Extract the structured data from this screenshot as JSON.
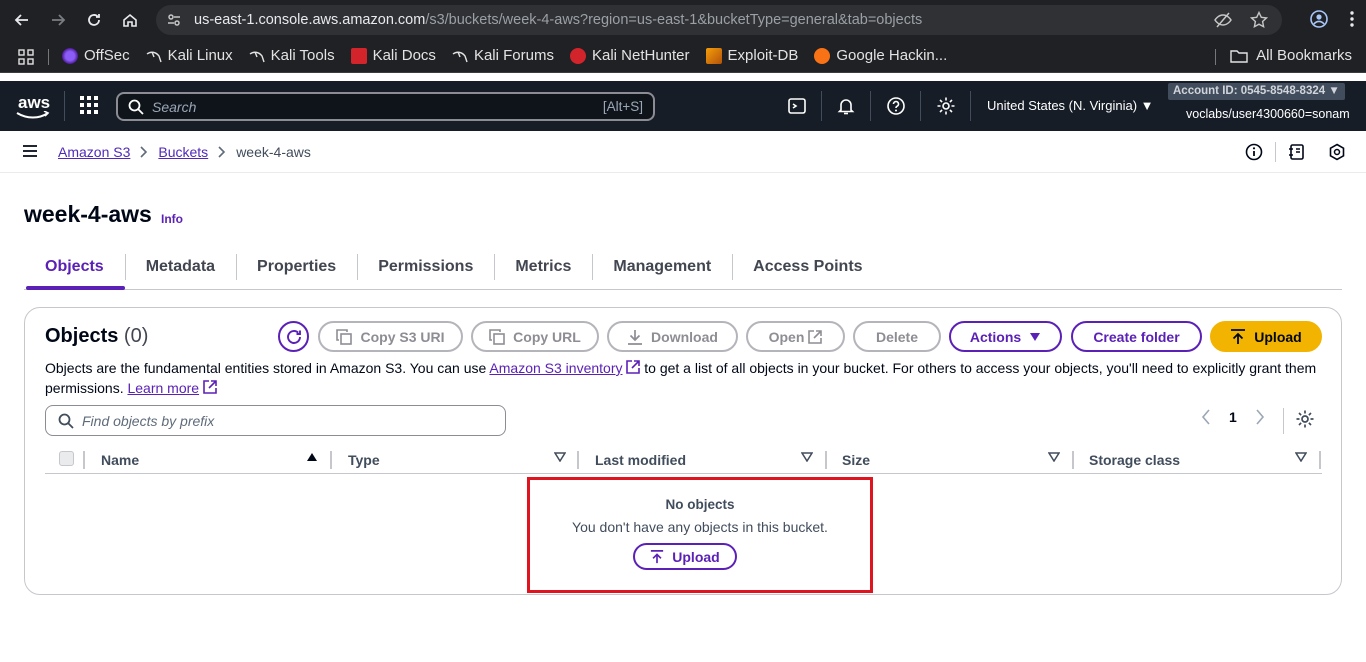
{
  "browser": {
    "url_host": "us-east-1.console.aws.amazon.com",
    "url_path": "/s3/buckets/week-4-aws?region=us-east-1&bucketType=general&tab=objects",
    "bookmarks": [
      "OffSec",
      "Kali Linux",
      "Kali Tools",
      "Kali Docs",
      "Kali Forums",
      "Kali NetHunter",
      "Exploit-DB",
      "Google Hackin..."
    ],
    "all_bookmarks": "All Bookmarks"
  },
  "aws_header": {
    "logo": "aws",
    "search_placeholder": "Search",
    "search_hint": "[Alt+S]",
    "region": "United States (N. Virginia) ▼",
    "account_id": "Account ID: 0545-8548-8324 ▼",
    "user": "voclabs/user4300660=sonam"
  },
  "breadcrumb": {
    "items": [
      "Amazon S3",
      "Buckets"
    ],
    "current": "week-4-aws"
  },
  "page": {
    "title": "week-4-aws",
    "info": "Info"
  },
  "tabs": [
    "Objects",
    "Metadata",
    "Properties",
    "Permissions",
    "Metrics",
    "Management",
    "Access Points"
  ],
  "objects_panel": {
    "title": "Objects",
    "count": "(0)",
    "buttons": {
      "copy_s3_uri": "Copy S3 URI",
      "copy_url": "Copy URL",
      "download": "Download",
      "open": "Open",
      "delete": "Delete",
      "actions": "Actions",
      "create_folder": "Create folder",
      "upload": "Upload"
    },
    "desc_part1": "Objects are the fundamental entities stored in Amazon S3. You can use ",
    "desc_link1": "Amazon S3 inventory",
    "desc_part2": " to get a list of all objects in your bucket. For others to access your objects, you'll need to explicitly grant them permissions. ",
    "desc_link2": "Learn more",
    "find_placeholder": "Find objects by prefix",
    "page_number": "1",
    "columns": [
      "Name",
      "Type",
      "Last modified",
      "Size",
      "Storage class"
    ],
    "empty": {
      "title": "No objects",
      "message": "You don't have any objects in this bucket.",
      "upload": "Upload"
    }
  },
  "colors": {
    "accent": "#5b21b6",
    "upload_button": "#f2b400",
    "aws_header_bg": "#161d26",
    "highlight_box": "#e0141e"
  }
}
